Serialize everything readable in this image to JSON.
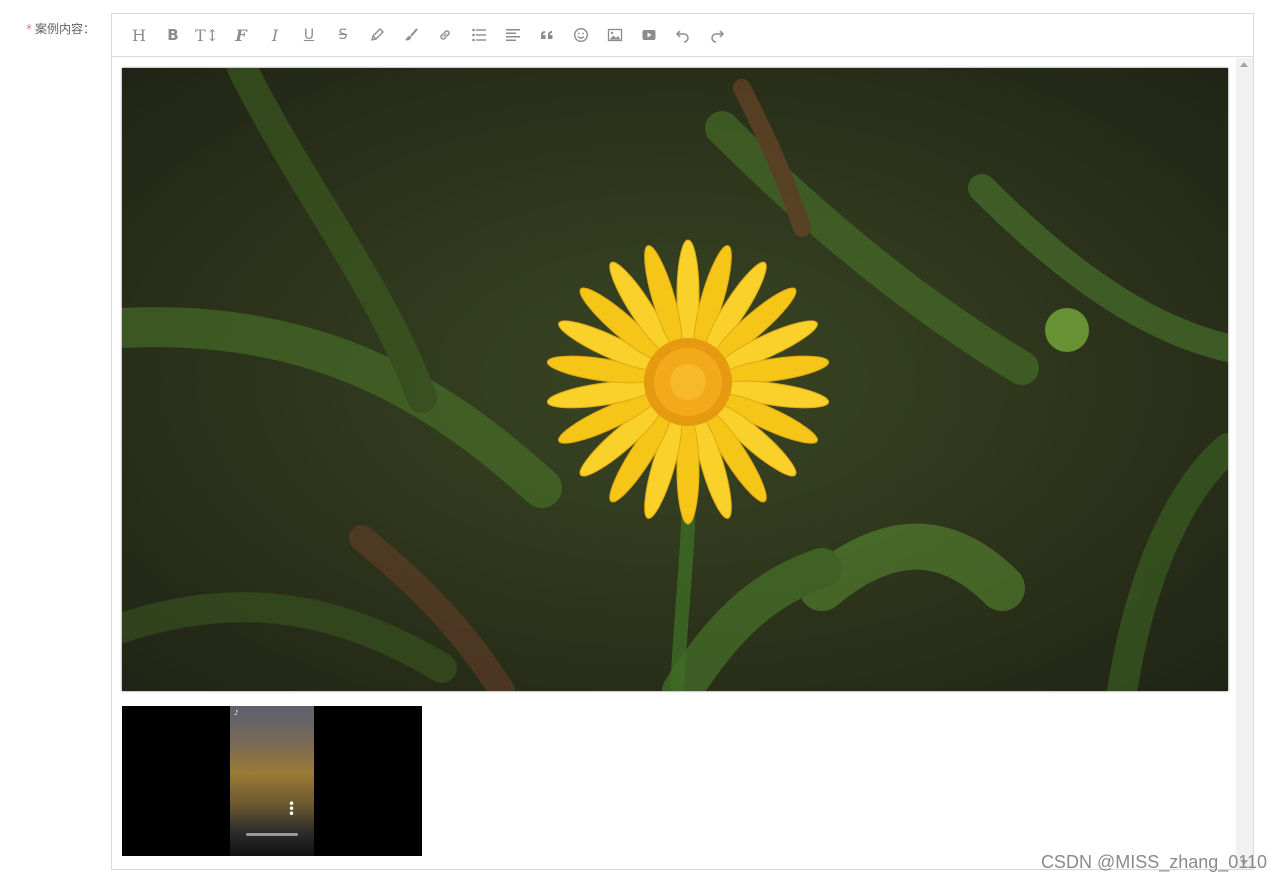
{
  "form": {
    "required_mark": "*",
    "label": "案例内容："
  },
  "toolbar": {
    "buttons": [
      {
        "name": "heading",
        "icon": "heading-icon",
        "glyph": "H"
      },
      {
        "name": "bold",
        "icon": "bold-icon",
        "glyph": "B"
      },
      {
        "name": "font-size",
        "icon": "font-size-icon",
        "glyph": "T↕"
      },
      {
        "name": "font-family",
        "icon": "font-family-icon",
        "glyph": "F"
      },
      {
        "name": "italic",
        "icon": "italic-icon",
        "glyph": "I"
      },
      {
        "name": "underline",
        "icon": "underline-icon",
        "glyph": "U"
      },
      {
        "name": "strikethrough",
        "icon": "strikethrough-icon",
        "glyph": "S"
      },
      {
        "name": "text-color",
        "icon": "pencil-icon"
      },
      {
        "name": "background-color",
        "icon": "brush-icon"
      },
      {
        "name": "link",
        "icon": "link-icon"
      },
      {
        "name": "list",
        "icon": "list-icon"
      },
      {
        "name": "justify",
        "icon": "align-icon"
      },
      {
        "name": "quote",
        "icon": "quote-icon"
      },
      {
        "name": "emoticon",
        "icon": "emoji-icon"
      },
      {
        "name": "image",
        "icon": "image-icon"
      },
      {
        "name": "video",
        "icon": "video-icon"
      },
      {
        "name": "undo",
        "icon": "undo-icon"
      },
      {
        "name": "redo",
        "icon": "redo-icon"
      }
    ]
  },
  "content": {
    "image": {
      "subject": "yellow daisy flower on blurred green grass"
    },
    "video": {
      "subject": "video thumbnail, vertical phone recording"
    }
  },
  "watermark": "CSDN @MISS_zhang_0110",
  "colors": {
    "required": "#f56c6c",
    "border": "#d9d9d9",
    "icon": "#8c8c8c"
  }
}
